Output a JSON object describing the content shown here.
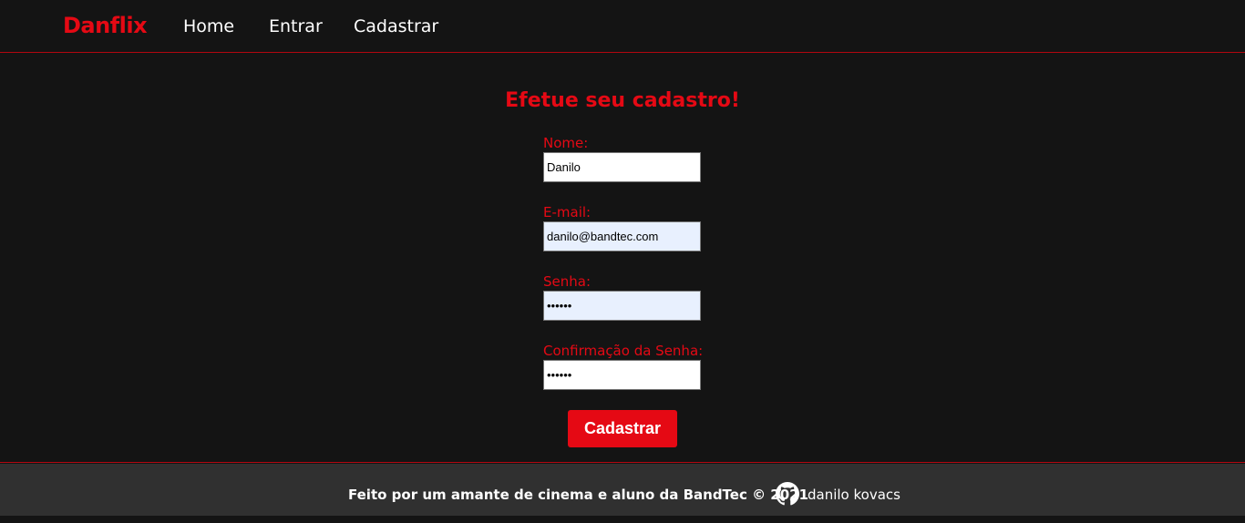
{
  "navbar": {
    "logo": "Danflix",
    "links": [
      "Home",
      "Entrar",
      "Cadastrar"
    ]
  },
  "form": {
    "title": "Efetue seu cadastro!",
    "fields": [
      {
        "label": "Nome:",
        "value": "Danilo"
      },
      {
        "label": "E-mail:",
        "value": "danilo@bandtec.com"
      },
      {
        "label": "Senha:",
        "value": "••••••"
      },
      {
        "label": "Confirmação da Senha:",
        "value": "••••••"
      }
    ],
    "submit_label": "Cadastrar"
  },
  "footer": {
    "text": "Feito por um amante de cinema e aluno da BandTec © 2021",
    "icon": "github-icon",
    "author": "danilo kovacs"
  },
  "colors": {
    "accent": "#e50914",
    "background": "#141414",
    "footer": "#303030"
  }
}
